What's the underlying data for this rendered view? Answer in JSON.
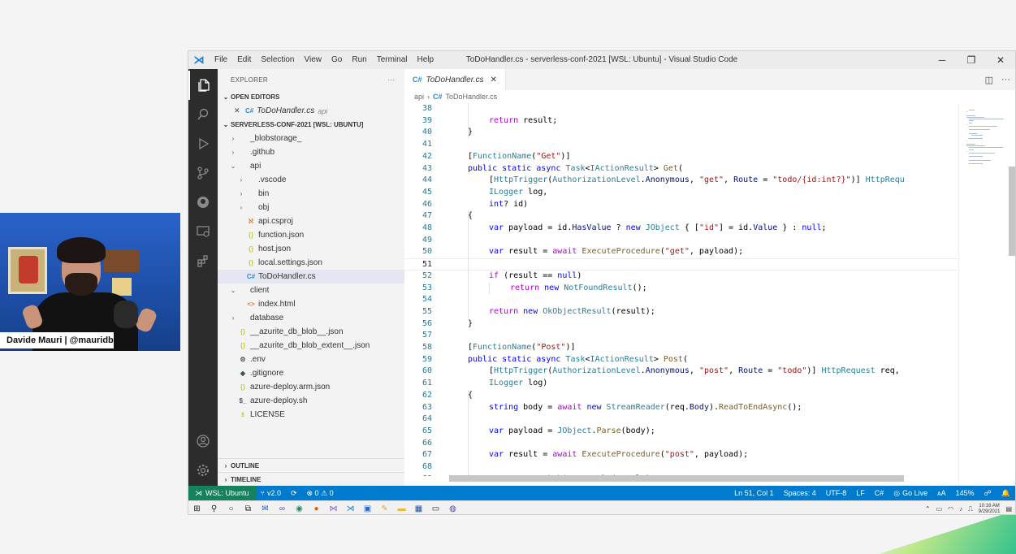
{
  "webcam": {
    "nameplate": "Davide Mauri | @mauridb"
  },
  "titlebar": {
    "menu": [
      "File",
      "Edit",
      "Selection",
      "View",
      "Go",
      "Run",
      "Terminal",
      "Help"
    ],
    "title": "ToDoHandler.cs - serverless-conf-2021 [WSL: Ubuntu] - Visual Studio Code",
    "controls": [
      "─",
      "❐",
      "✕"
    ]
  },
  "activity_bar": {
    "items": [
      "explorer-icon",
      "search-icon",
      "run-debug-icon",
      "source-control-icon",
      "github-icon",
      "remote-explorer-icon",
      "extensions-icon",
      "account-icon",
      "settings-gear-icon"
    ]
  },
  "sidebar": {
    "header": "EXPLORER",
    "more": "···",
    "open_editors_label": "OPEN EDITORS",
    "open_editor": {
      "name": "ToDoHandler.cs",
      "folder": "api",
      "close": "✕"
    },
    "workspace_label": "SERVERLESS-CONF-2021 [WSL: UBUNTU]",
    "tree": [
      {
        "name": "_blobstorage_",
        "depth": 1,
        "chev": "›",
        "icon": "",
        "color": "#333333",
        "selected": false
      },
      {
        "name": ".github",
        "depth": 1,
        "chev": "›",
        "icon": "",
        "color": "#333333",
        "selected": false
      },
      {
        "name": "api",
        "depth": 1,
        "chev": "⌄",
        "icon": "",
        "color": "#333333",
        "selected": false
      },
      {
        "name": ".vscode",
        "depth": 2,
        "chev": "›",
        "icon": "",
        "color": "#333333",
        "selected": false
      },
      {
        "name": "bin",
        "depth": 2,
        "chev": "›",
        "icon": "",
        "color": "#333333",
        "selected": false
      },
      {
        "name": "obj",
        "depth": 2,
        "chev": "›",
        "icon": "",
        "color": "#333333",
        "selected": false
      },
      {
        "name": "api.csproj",
        "depth": 2,
        "chev": "",
        "icon": "ℵ",
        "color": "#e37933",
        "selected": false
      },
      {
        "name": "function.json",
        "depth": 2,
        "chev": "",
        "icon": "{}",
        "color": "#cbcb41",
        "selected": false
      },
      {
        "name": "host.json",
        "depth": 2,
        "chev": "",
        "icon": "{}",
        "color": "#cbcb41",
        "selected": false
      },
      {
        "name": "local.settings.json",
        "depth": 2,
        "chev": "",
        "icon": "{}",
        "color": "#cbcb41",
        "selected": false
      },
      {
        "name": "ToDoHandler.cs",
        "depth": 2,
        "chev": "",
        "icon": "C#",
        "color": "#2a8bd0",
        "selected": true
      },
      {
        "name": "client",
        "depth": 1,
        "chev": "⌄",
        "icon": "",
        "color": "#333333",
        "selected": false
      },
      {
        "name": "index.html",
        "depth": 2,
        "chev": "",
        "icon": "<>",
        "color": "#e37933",
        "selected": false
      },
      {
        "name": "database",
        "depth": 1,
        "chev": "›",
        "icon": "",
        "color": "#333333",
        "selected": false
      },
      {
        "name": "__azurite_db_blob__.json",
        "depth": 1,
        "chev": "",
        "icon": "{}",
        "color": "#cbcb41",
        "selected": false
      },
      {
        "name": "__azurite_db_blob_extent__.json",
        "depth": 1,
        "chev": "",
        "icon": "{}",
        "color": "#cbcb41",
        "selected": false
      },
      {
        "name": ".env",
        "depth": 1,
        "chev": "",
        "icon": "⚙",
        "color": "#555555",
        "selected": false
      },
      {
        "name": ".gitignore",
        "depth": 1,
        "chev": "",
        "icon": "◆",
        "color": "#41535b",
        "selected": false
      },
      {
        "name": "azure-deploy.arm.json",
        "depth": 1,
        "chev": "",
        "icon": "{}",
        "color": "#cbcb41",
        "selected": false
      },
      {
        "name": "azure-deploy.sh",
        "depth": 1,
        "chev": "",
        "icon": "$_",
        "color": "#4d5a5e",
        "selected": false
      },
      {
        "name": "LICENSE",
        "depth": 1,
        "chev": "",
        "icon": "♗",
        "color": "#cbcb41",
        "selected": false
      }
    ],
    "outline_label": "OUTLINE",
    "timeline_label": "TIMELINE"
  },
  "editor": {
    "tab": {
      "icon": "C#",
      "label": "ToDoHandler.cs",
      "close": "✕"
    },
    "breadcrumb": [
      "api",
      "›",
      "C#",
      "ToDoHandler.cs"
    ],
    "current_line": 51,
    "lines": [
      {
        "n": 38,
        "i": 0,
        "t": [
          [
            "",
            ""
          ]
        ]
      },
      {
        "n": 39,
        "i": 2,
        "t": [
          [
            "kwc",
            "return"
          ],
          [
            "",
            " result;"
          ]
        ]
      },
      {
        "n": 40,
        "i": 1,
        "t": [
          [
            "",
            "}"
          ]
        ]
      },
      {
        "n": 41,
        "i": 0,
        "t": [
          [
            "",
            ""
          ]
        ]
      },
      {
        "n": 42,
        "i": 1,
        "t": [
          [
            "",
            "["
          ],
          [
            "attr",
            "FunctionName"
          ],
          [
            "",
            "("
          ],
          [
            "str",
            "\"Get\""
          ],
          [
            "",
            ")]"
          ]
        ]
      },
      {
        "n": 43,
        "i": 1,
        "t": [
          [
            "kw",
            "public static async "
          ],
          [
            "type",
            "Task"
          ],
          [
            "",
            "<"
          ],
          [
            "type",
            "IActionResult"
          ],
          [
            "",
            "> "
          ],
          [
            "fn",
            "Get"
          ],
          [
            "",
            "("
          ]
        ]
      },
      {
        "n": 44,
        "i": 2,
        "t": [
          [
            "",
            "["
          ],
          [
            "attr",
            "HttpTrigger"
          ],
          [
            "",
            "("
          ],
          [
            "type",
            "AuthorizationLevel"
          ],
          [
            "",
            "."
          ],
          [
            "var",
            "Anonymous"
          ],
          [
            "",
            ", "
          ],
          [
            "str",
            "\"get\""
          ],
          [
            "",
            ", "
          ],
          [
            "var",
            "Route"
          ],
          [
            "",
            " = "
          ],
          [
            "str",
            "\"todo/{id:int?}\""
          ],
          [
            "",
            ")] "
          ],
          [
            "type",
            "HttpRequ"
          ]
        ]
      },
      {
        "n": 45,
        "i": 2,
        "t": [
          [
            "type",
            "ILogger"
          ],
          [
            "",
            " log,"
          ]
        ]
      },
      {
        "n": 46,
        "i": 2,
        "t": [
          [
            "kw",
            "int"
          ],
          [
            "",
            "? id)"
          ]
        ]
      },
      {
        "n": 47,
        "i": 1,
        "t": [
          [
            "",
            "{"
          ]
        ]
      },
      {
        "n": 48,
        "i": 2,
        "t": [
          [
            "kw",
            "var"
          ],
          [
            "",
            " payload = id."
          ],
          [
            "var",
            "HasValue"
          ],
          [
            "",
            " ? "
          ],
          [
            "kw",
            "new"
          ],
          [
            "",
            " "
          ],
          [
            "type",
            "JObject"
          ],
          [
            "",
            " { ["
          ],
          [
            "str",
            "\"id\""
          ],
          [
            "",
            "] = id."
          ],
          [
            "var",
            "Value"
          ],
          [
            "",
            " } : "
          ],
          [
            "kw",
            "null"
          ],
          [
            "",
            ";"
          ]
        ]
      },
      {
        "n": 49,
        "i": 0,
        "t": [
          [
            "",
            ""
          ]
        ]
      },
      {
        "n": 50,
        "i": 2,
        "t": [
          [
            "kw",
            "var"
          ],
          [
            "",
            " result = "
          ],
          [
            "kwc",
            "await"
          ],
          [
            "",
            " "
          ],
          [
            "fn",
            "ExecuteProcedure"
          ],
          [
            "",
            "("
          ],
          [
            "str",
            "\"get\""
          ],
          [
            "",
            ", payload);"
          ]
        ]
      },
      {
        "n": 51,
        "i": 0,
        "t": [
          [
            "",
            ""
          ]
        ]
      },
      {
        "n": 52,
        "i": 2,
        "t": [
          [
            "kwc",
            "if"
          ],
          [
            "",
            " (result == "
          ],
          [
            "kw",
            "null"
          ],
          [
            "",
            ")"
          ]
        ]
      },
      {
        "n": 53,
        "i": 3,
        "t": [
          [
            "kwc",
            "return"
          ],
          [
            "",
            " "
          ],
          [
            "kw",
            "new"
          ],
          [
            "",
            " "
          ],
          [
            "type",
            "NotFoundResult"
          ],
          [
            "",
            "();"
          ]
        ]
      },
      {
        "n": 54,
        "i": 0,
        "t": [
          [
            "",
            ""
          ]
        ]
      },
      {
        "n": 55,
        "i": 2,
        "t": [
          [
            "kwc",
            "return"
          ],
          [
            "",
            " "
          ],
          [
            "kw",
            "new"
          ],
          [
            "",
            " "
          ],
          [
            "type",
            "OkObjectResult"
          ],
          [
            "",
            "(result);"
          ]
        ]
      },
      {
        "n": 56,
        "i": 1,
        "t": [
          [
            "",
            "}"
          ]
        ]
      },
      {
        "n": 57,
        "i": 0,
        "t": [
          [
            "",
            ""
          ]
        ]
      },
      {
        "n": 58,
        "i": 1,
        "t": [
          [
            "",
            "["
          ],
          [
            "attr",
            "FunctionName"
          ],
          [
            "",
            "("
          ],
          [
            "str",
            "\"Post\""
          ],
          [
            "",
            ")]"
          ]
        ]
      },
      {
        "n": 59,
        "i": 1,
        "t": [
          [
            "kw",
            "public static async "
          ],
          [
            "type",
            "Task"
          ],
          [
            "",
            "<"
          ],
          [
            "type",
            "IActionResult"
          ],
          [
            "",
            "> "
          ],
          [
            "fn",
            "Post"
          ],
          [
            "",
            "("
          ]
        ]
      },
      {
        "n": 60,
        "i": 2,
        "t": [
          [
            "",
            "["
          ],
          [
            "attr",
            "HttpTrigger"
          ],
          [
            "",
            "("
          ],
          [
            "type",
            "AuthorizationLevel"
          ],
          [
            "",
            "."
          ],
          [
            "var",
            "Anonymous"
          ],
          [
            "",
            ", "
          ],
          [
            "str",
            "\"post\""
          ],
          [
            "",
            ", "
          ],
          [
            "var",
            "Route"
          ],
          [
            "",
            " = "
          ],
          [
            "str",
            "\"todo\""
          ],
          [
            "",
            ")] "
          ],
          [
            "type",
            "HttpRequest"
          ],
          [
            "",
            " req,"
          ]
        ]
      },
      {
        "n": 61,
        "i": 2,
        "t": [
          [
            "type",
            "ILogger"
          ],
          [
            "",
            " log)"
          ]
        ]
      },
      {
        "n": 62,
        "i": 1,
        "t": [
          [
            "",
            "{"
          ]
        ]
      },
      {
        "n": 63,
        "i": 2,
        "t": [
          [
            "kw",
            "string"
          ],
          [
            "",
            " body = "
          ],
          [
            "kwc",
            "await"
          ],
          [
            "",
            " "
          ],
          [
            "kw",
            "new"
          ],
          [
            "",
            " "
          ],
          [
            "type",
            "StreamReader"
          ],
          [
            "",
            "(req."
          ],
          [
            "var",
            "Body"
          ],
          [
            "",
            ")."
          ],
          [
            "fn",
            "ReadToEndAsync"
          ],
          [
            "",
            "();"
          ]
        ]
      },
      {
        "n": 64,
        "i": 0,
        "t": [
          [
            "",
            ""
          ]
        ]
      },
      {
        "n": 65,
        "i": 2,
        "t": [
          [
            "kw",
            "var"
          ],
          [
            "",
            " payload = "
          ],
          [
            "type",
            "JObject"
          ],
          [
            "",
            "."
          ],
          [
            "fn",
            "Parse"
          ],
          [
            "",
            "(body);"
          ]
        ]
      },
      {
        "n": 66,
        "i": 0,
        "t": [
          [
            "",
            ""
          ]
        ]
      },
      {
        "n": 67,
        "i": 2,
        "t": [
          [
            "kw",
            "var"
          ],
          [
            "",
            " result = "
          ],
          [
            "kwc",
            "await"
          ],
          [
            "",
            " "
          ],
          [
            "fn",
            "ExecuteProcedure"
          ],
          [
            "",
            "("
          ],
          [
            "str",
            "\"post\""
          ],
          [
            "",
            ", payload);"
          ]
        ]
      },
      {
        "n": 68,
        "i": 0,
        "t": [
          [
            "",
            ""
          ]
        ]
      },
      {
        "n": 69,
        "i": 2,
        "t": [
          [
            "kwc",
            "return"
          ],
          [
            "",
            " "
          ],
          [
            "kw",
            "new"
          ],
          [
            "",
            " "
          ],
          [
            "type",
            "OkObjectResult"
          ],
          [
            "",
            "(result);"
          ]
        ]
      }
    ]
  },
  "statusbar": {
    "remote": "WSL: Ubuntu",
    "branch": "v2.0",
    "sync": "⟳",
    "problems": "⊗ 0 ⚠ 0",
    "position": "Ln 51, Col 1",
    "spaces": "Spaces: 4",
    "encoding": "UTF-8",
    "eol": "LF",
    "language": "C#",
    "golive": "Go Live",
    "font": "ᴀA",
    "zoom": "145%",
    "feedback": "☍",
    "bell": "🔔"
  },
  "taskbar": {
    "icons": [
      {
        "name": "windows-start-icon",
        "glyph": "⊞",
        "color": "#222222"
      },
      {
        "name": "search-icon",
        "glyph": "⚲",
        "color": "#222222"
      },
      {
        "name": "cortana-icon",
        "glyph": "○",
        "color": "#222222"
      },
      {
        "name": "task-view-icon",
        "glyph": "⧉",
        "color": "#222222"
      },
      {
        "name": "outlook-icon",
        "glyph": "✉",
        "color": "#0a64c8"
      },
      {
        "name": "visual-studio-icon",
        "glyph": "∞",
        "color": "#6c3bb5"
      },
      {
        "name": "edge-icon",
        "glyph": "◉",
        "color": "#1a8f66"
      },
      {
        "name": "firefox-icon",
        "glyph": "●",
        "color": "#e66000"
      },
      {
        "name": "visual-studio-purple-icon",
        "glyph": "⋈",
        "color": "#865fc5"
      },
      {
        "name": "vscode-icon",
        "glyph": "⋊",
        "color": "#1d7ed3"
      },
      {
        "name": "remote-desktop-icon",
        "glyph": "▣",
        "color": "#2b6cc4"
      },
      {
        "name": "paint-icon",
        "glyph": "✎",
        "color": "#e0a53a"
      },
      {
        "name": "file-explorer-icon",
        "glyph": "▬",
        "color": "#e8b93b"
      },
      {
        "name": "slides-icon",
        "glyph": "▦",
        "color": "#1b4fa0"
      },
      {
        "name": "terminal-icon",
        "glyph": "▭",
        "color": "#222222"
      },
      {
        "name": "obs-icon",
        "glyph": "◍",
        "color": "#5a3fa0"
      }
    ],
    "tray": [
      "⌃",
      "▭",
      "◠",
      "♪",
      "⎍"
    ],
    "time": "10:16 AM",
    "date": "9/29/2021",
    "notifications": "▤"
  },
  "colors": {
    "statusbar": "#007acc",
    "remote": "#16825d",
    "activity_bar": "#2c2c2c",
    "sidebar": "#f3f3f3"
  }
}
